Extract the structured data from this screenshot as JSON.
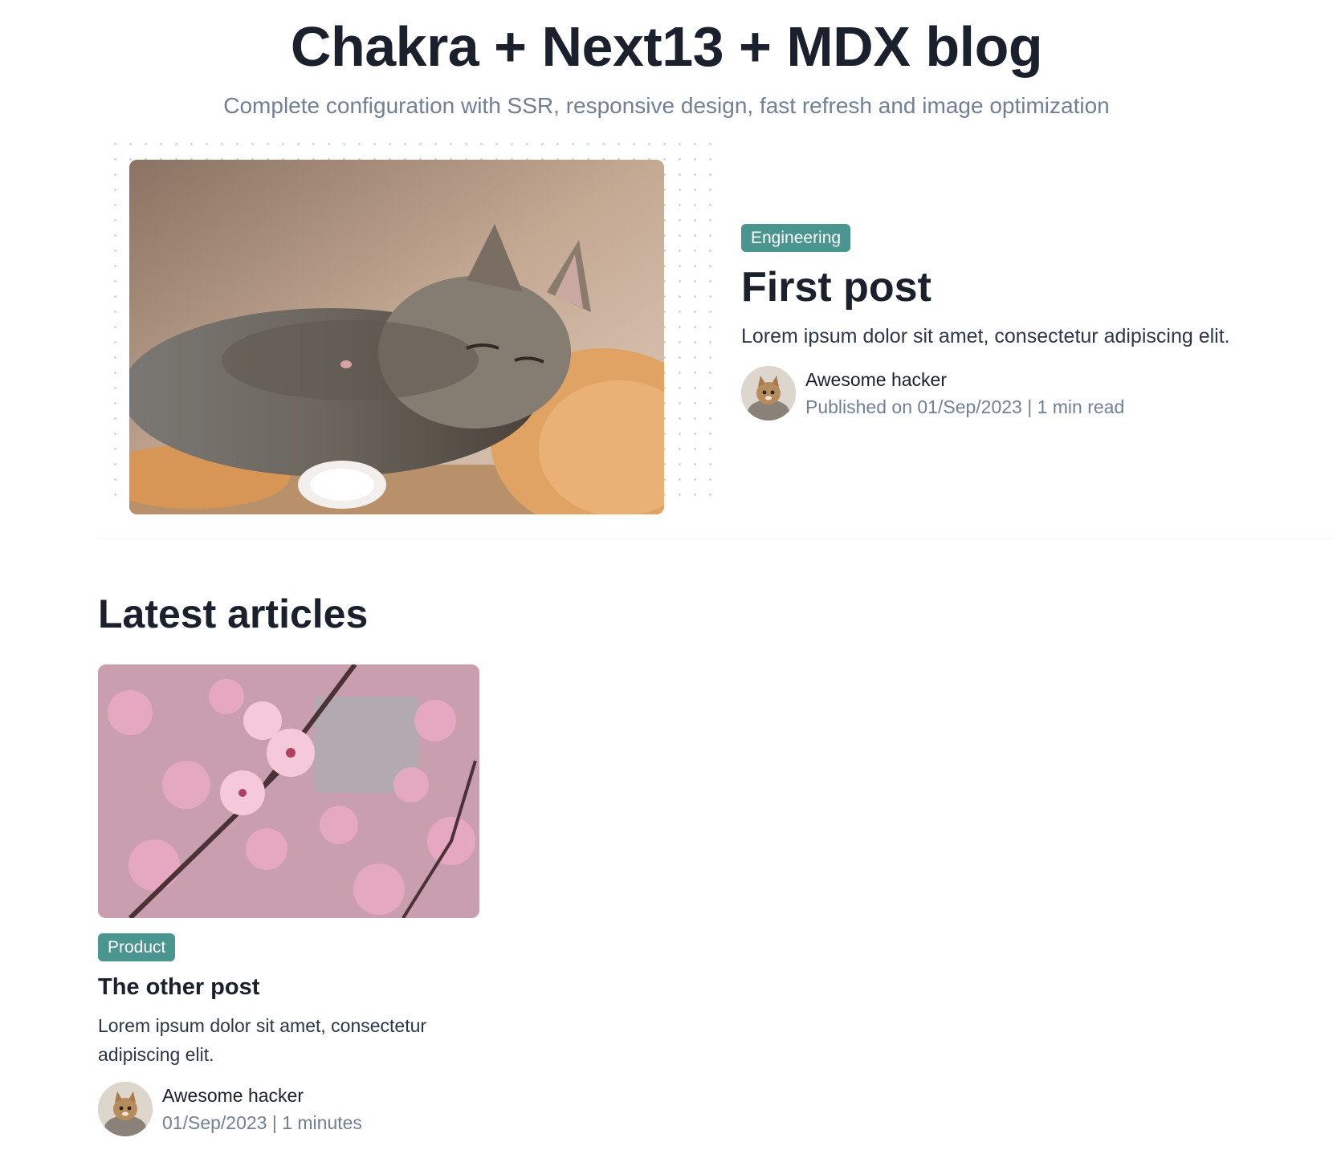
{
  "header": {
    "title": "Chakra + Next13 + MDX blog",
    "subtitle": "Complete configuration with SSR, responsive design, fast refresh and image optimization"
  },
  "featured_post": {
    "category": "Engineering",
    "title": "First post",
    "excerpt": "Lorem ipsum dolor sit amet, consectetur adipiscing elit.",
    "author": "Awesome hacker",
    "meta": "Published on 01/Sep/2023 | 1 min read"
  },
  "latest": {
    "heading": "Latest articles",
    "articles": [
      {
        "category": "Product",
        "title": "The other post",
        "excerpt": "Lorem ipsum dolor sit amet, consectetur adipiscing elit.",
        "author": "Awesome hacker",
        "meta": "01/Sep/2023 | 1 minutes"
      }
    ]
  },
  "colors": {
    "badge": "#4b9590",
    "heading": "#1a202c",
    "muted": "#718096"
  }
}
